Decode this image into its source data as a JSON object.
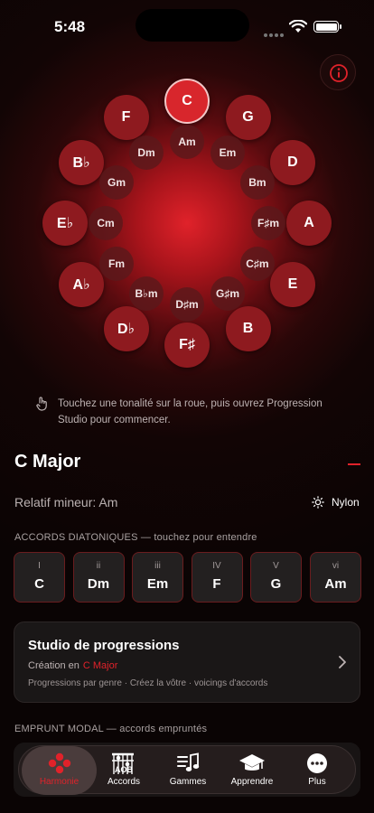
{
  "status": {
    "time": "5:48"
  },
  "wheel": {
    "major_keys": [
      "C",
      "G",
      "D",
      "A",
      "E",
      "B",
      "F♯",
      "D♭",
      "A♭",
      "E♭",
      "B♭",
      "F"
    ],
    "minor_keys": [
      "Am",
      "Em",
      "Bm",
      "F♯m",
      "C♯m",
      "G♯m",
      "D♯m",
      "B♭m",
      "Fm",
      "Cm",
      "Gm",
      "Dm"
    ],
    "selected": "C"
  },
  "hint": {
    "text": "Touchez une tonalité sur la roue, puis ouvrez Progression Studio pour commencer."
  },
  "key_info": {
    "title": "C Major",
    "relative": "Relatif mineur: Am",
    "instrument": "Nylon"
  },
  "diatonic": {
    "heading": "ACCORDS DIATONIQUES — touchez pour entendre",
    "chords": [
      {
        "degree": "I",
        "name": "C"
      },
      {
        "degree": "ii",
        "name": "Dm"
      },
      {
        "degree": "iii",
        "name": "Em"
      },
      {
        "degree": "IV",
        "name": "F"
      },
      {
        "degree": "V",
        "name": "G"
      },
      {
        "degree": "vi",
        "name": "Am"
      }
    ]
  },
  "studio": {
    "title": "Studio de progressions",
    "creation_label": "Création en",
    "creation_key": "C Major",
    "subtitle": "Progressions par genre · Créez la vôtre · voicings d'accords"
  },
  "modal": {
    "heading": "EMPRUNT MODAL — accords empruntés"
  },
  "tabs": [
    {
      "label": "Harmonie",
      "icon": "harmony-icon",
      "active": true
    },
    {
      "label": "Accords",
      "icon": "chords-icon"
    },
    {
      "label": "Gammes",
      "icon": "scales-icon"
    },
    {
      "label": "Apprendre",
      "icon": "graduation-cap-icon"
    },
    {
      "label": "Plus",
      "icon": "more-icon"
    }
  ],
  "colors": {
    "accent": "#e0222a",
    "key_fill": "#8e1a1f",
    "minor_fill": "#5a191b"
  }
}
